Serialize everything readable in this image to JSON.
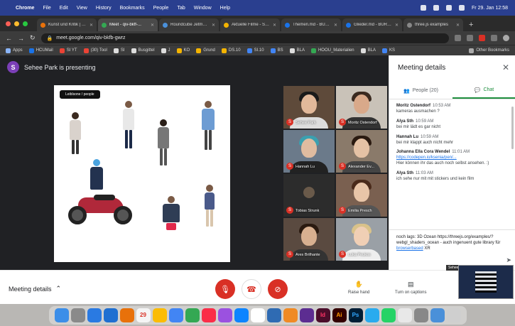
{
  "menubar": {
    "app": "Chrome",
    "items": [
      "File",
      "Edit",
      "View",
      "History",
      "Bookmarks",
      "People",
      "Tab",
      "Window",
      "Help"
    ],
    "clock": "Fr 29. Jan 12:58"
  },
  "tabs": [
    {
      "label": "Kunst und Kritik | 1..."
    },
    {
      "label": "Meet - qiv-bkff-..."
    },
    {
      "label": "Roundcube Jetmail..."
    },
    {
      "label": "Aktuelle Filme - Sor..."
    },
    {
      "label": "Themen.md - BURN..."
    },
    {
      "label": "Glieder.md - BURN..."
    },
    {
      "label": "three.js examples"
    }
  ],
  "toolbar": {
    "url": "meet.google.com/qiv-bkfb-gwrz"
  },
  "bookmarks": [
    "Apps",
    "HCUMail",
    "SI YT",
    "(30) Tool",
    "SI",
    "Busgittel",
    "J",
    "KO",
    "Grund",
    "DS.10",
    "SI.10",
    "BS",
    "BLA",
    "HOOU_Materialien",
    "BLA",
    "KS"
  ],
  "bookmarks_other": "Other Bookmarks",
  "meet": {
    "presenter_initial": "S",
    "presenter_text": "Sehee Park is presenting",
    "slide_label": "Leiblsone / people"
  },
  "participants": [
    {
      "name": "Sehee Park",
      "initial": "S"
    },
    {
      "name": "Moritz Ostendorf",
      "initial": "S"
    },
    {
      "name": "Hannah Lu",
      "initial": "S"
    },
    {
      "name": "Alexander Ev...",
      "initial": "S"
    },
    {
      "name": "Tobias Strunk",
      "initial": "S"
    },
    {
      "name": "Emilia Presch",
      "initial": "S"
    },
    {
      "name": "Ares Brilhante",
      "initial": "S"
    },
    {
      "name": "Luka Peukos",
      "initial": "S"
    }
  ],
  "panel": {
    "title": "Meeting details",
    "tab_people": "People (20)",
    "tab_chat": "Chat",
    "messages": [
      {
        "author": "Moritz Ostendorf",
        "time": "10:53 AM",
        "text": "kameras ausmachen ?",
        "link": ""
      },
      {
        "author": "Alya Sth",
        "time": "10:59 AM",
        "text": "bei mir lädt es gar nicht",
        "link": ""
      },
      {
        "author": "Hannah Lu",
        "time": "10:59 AM",
        "text": "bei mir klappt auch nicht mehr",
        "link": ""
      },
      {
        "author": "Johanna Ella Cora Wendel",
        "time": "11:01 AM",
        "text": "Hier können ihr das auch noch selbst ansehen. :)",
        "link": "https://codepen.io/ksenia/pen/..."
      },
      {
        "author": "Alya Sth",
        "time": "11:03 AM",
        "text": "ich sehe nur mit mit stickers und kein film",
        "link": ""
      }
    ],
    "compose_text": "noch lags: 3D Ozean https://threejs.org/examples/?webgl_shaders_ocean - auch ingenuent gute library für",
    "compose_link": "browserbased",
    "compose_tail": "XR"
  },
  "bottombar": {
    "meeting_details": "Meeting details",
    "raise_hand": "Raise hand",
    "captions": "Turn on captions",
    "pip_label": "Sehee..."
  },
  "colors": {
    "accent_green": "#1e8e3e",
    "danger_red": "#d93025",
    "menubar_blue": "#2a3f8f"
  }
}
